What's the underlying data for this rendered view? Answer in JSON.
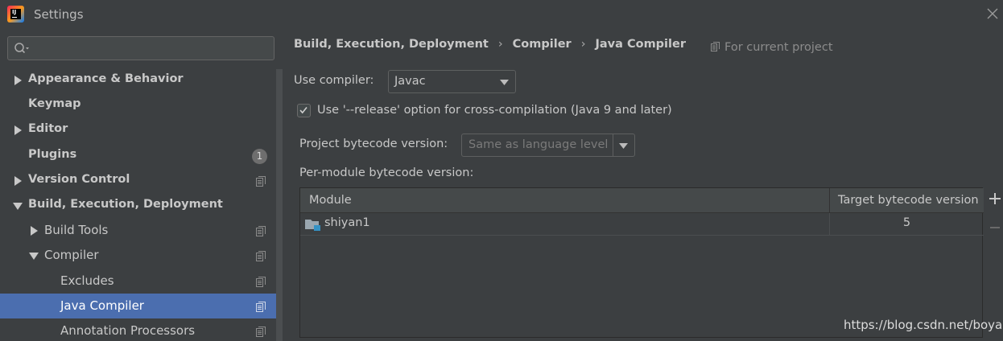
{
  "window": {
    "title": "Settings",
    "logo_text": "IJ"
  },
  "sidebar": {
    "search": {
      "value": "",
      "placeholder": ""
    },
    "items": [
      {
        "label": "Appearance & Behavior",
        "bold": true,
        "expander": "collapsed",
        "project_scoped": false
      },
      {
        "label": "Keymap",
        "bold": true,
        "expander": "none",
        "project_scoped": false
      },
      {
        "label": "Editor",
        "bold": true,
        "expander": "collapsed",
        "project_scoped": false
      },
      {
        "label": "Plugins",
        "bold": true,
        "expander": "none",
        "badge": "1"
      },
      {
        "label": "Version Control",
        "bold": true,
        "expander": "collapsed",
        "project_scoped": true
      },
      {
        "label": "Build, Execution, Deployment",
        "bold": true,
        "expander": "expanded",
        "project_scoped": false
      },
      {
        "label": "Build Tools",
        "bold": false,
        "expander": "collapsed",
        "project_scoped": true
      },
      {
        "label": "Compiler",
        "bold": false,
        "expander": "expanded",
        "project_scoped": true
      },
      {
        "label": "Excludes",
        "bold": false,
        "expander": "none",
        "project_scoped": true
      },
      {
        "label": "Java Compiler",
        "bold": false,
        "expander": "none",
        "project_scoped": true,
        "selected": true
      },
      {
        "label": "Annotation Processors",
        "bold": false,
        "expander": "none",
        "project_scoped": true
      }
    ]
  },
  "main": {
    "breadcrumb": [
      "Build, Execution, Deployment",
      "Compiler",
      "Java Compiler"
    ],
    "breadcrumb_separator": "›",
    "scope_note": "For current project",
    "use_compiler": {
      "label": "Use compiler:",
      "value": "Javac"
    },
    "release_option": {
      "checked": true,
      "label": "Use '--release' option for cross-compilation (Java 9 and later)"
    },
    "project_bytecode": {
      "label": "Project bytecode version:",
      "value": "Same as language level"
    },
    "per_module": {
      "label": "Per-module bytecode version:",
      "columns": [
        "Module",
        "Target bytecode version"
      ],
      "rows": [
        {
          "module": "shiyan1",
          "target": "5"
        }
      ]
    }
  },
  "watermark": "https://blog.csdn.net/boyas",
  "colors": {
    "background": "#3c3f41",
    "selection": "#4b6eaf",
    "text": "#bbbbbb",
    "muted": "#7a7a7a",
    "module_icon_accent": "#3592c4"
  }
}
